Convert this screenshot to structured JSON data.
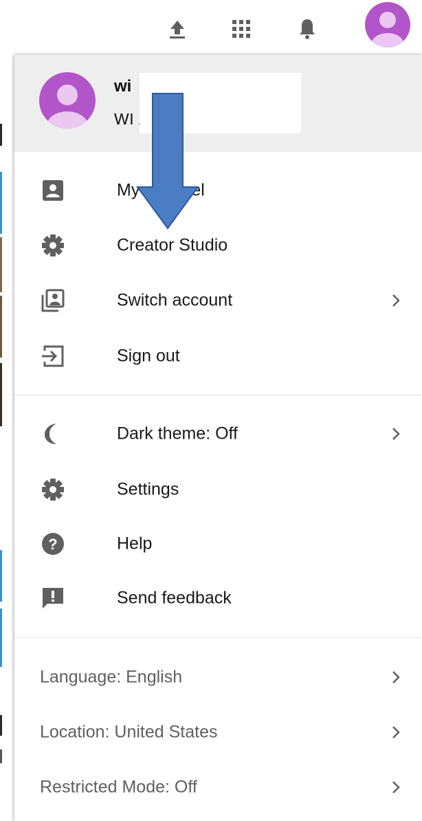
{
  "user": {
    "name": "wi",
    "email": "WI                                          ÃIL.COM"
  },
  "account_items": [
    {
      "label": "My channel",
      "icon": "account-box-icon"
    },
    {
      "label": "Creator Studio",
      "icon": "gear-icon"
    },
    {
      "label": "Switch account",
      "icon": "switch-account-icon"
    },
    {
      "label": "Sign out",
      "icon": "sign-out-icon"
    }
  ],
  "settings_items": [
    {
      "label": "Dark theme: Off",
      "icon": "moon-icon"
    },
    {
      "label": "Settings",
      "icon": "gear-icon"
    },
    {
      "label": "Help",
      "icon": "help-icon"
    },
    {
      "label": "Send feedback",
      "icon": "feedback-icon"
    }
  ],
  "footer_items": [
    {
      "label": "Language: English"
    },
    {
      "label": "Location: United States"
    },
    {
      "label": "Restricted Mode: Off"
    }
  ],
  "colors": {
    "avatar": "#b255c9",
    "icon": "#606060",
    "annotation_arrow": "#4a7dc4"
  }
}
